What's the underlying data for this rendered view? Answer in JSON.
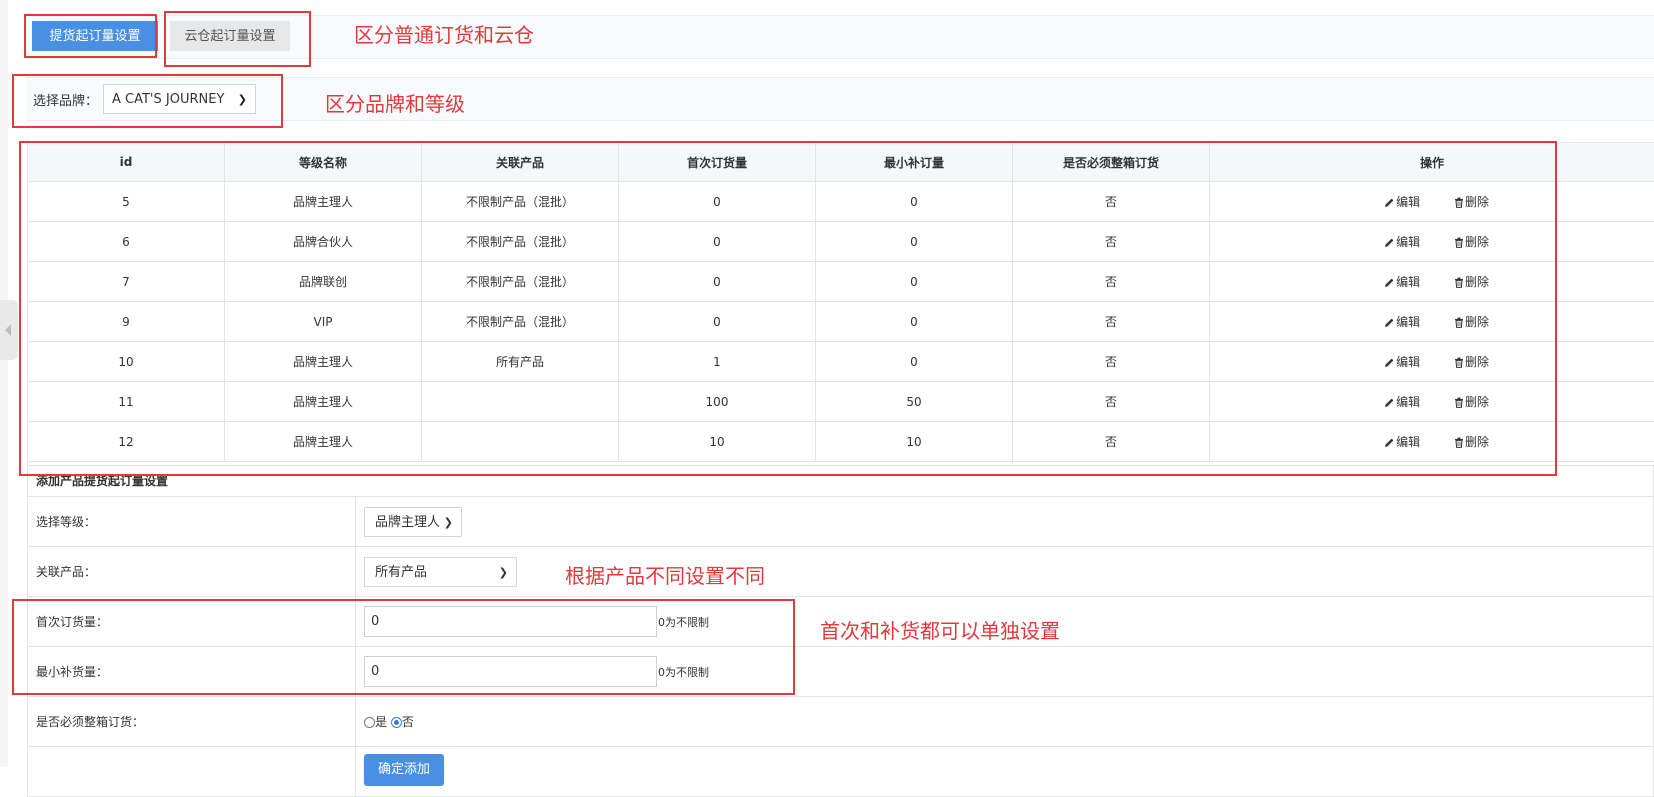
{
  "tabs": [
    {
      "label": "提货起订量设置",
      "active": true
    },
    {
      "label": "云仓起订量设置",
      "active": false
    }
  ],
  "brand": {
    "label": "选择品牌：",
    "selected": "A CAT'S JOURNEY"
  },
  "table": {
    "headers": [
      "id",
      "等级名称",
      "关联产品",
      "首次订货量",
      "最小补订量",
      "是否必须整箱订货",
      "操作"
    ],
    "rows": [
      {
        "id": "5",
        "level": "品牌主理人",
        "product": "不限制产品（混批）",
        "first": "0",
        "min": "0",
        "box": "否"
      },
      {
        "id": "6",
        "level": "品牌合伙人",
        "product": "不限制产品（混批）",
        "first": "0",
        "min": "0",
        "box": "否"
      },
      {
        "id": "7",
        "level": "品牌联创",
        "product": "不限制产品（混批）",
        "first": "0",
        "min": "0",
        "box": "否"
      },
      {
        "id": "9",
        "level": "VIP",
        "product": "不限制产品（混批）",
        "first": "0",
        "min": "0",
        "box": "否"
      },
      {
        "id": "10",
        "level": "品牌主理人",
        "product": "所有产品",
        "first": "1",
        "min": "0",
        "box": "否"
      },
      {
        "id": "11",
        "level": "品牌主理人",
        "product": "",
        "first": "100",
        "min": "50",
        "box": "否"
      },
      {
        "id": "12",
        "level": "品牌主理人",
        "product": "",
        "first": "10",
        "min": "10",
        "box": "否"
      }
    ],
    "edit_label": "编辑",
    "delete_label": "删除"
  },
  "form": {
    "title": "添加产品提货起订量设置",
    "level_label": "选择等级：",
    "level_value": "品牌主理人",
    "product_label": "关联产品：",
    "product_value": "所有产品",
    "first_label": "首次订货量：",
    "first_value": "0",
    "first_hint": "0为不限制",
    "min_label": "最小补货量：",
    "min_value": "0",
    "min_hint": "0为不限制",
    "box_label": "是否必须整箱订货：",
    "box_yes": "是",
    "box_no": "否",
    "box_selected": "否",
    "submit_label": "确定添加"
  },
  "annotations": {
    "tabs_note": "区分普通订货和云仓",
    "brand_note": "区分品牌和等级",
    "product_note": "根据产品不同设置不同",
    "qty_note": "首次和补货都可以单独设置"
  },
  "colors": {
    "accent": "#4a90e2",
    "annotation": "#e4393c"
  }
}
